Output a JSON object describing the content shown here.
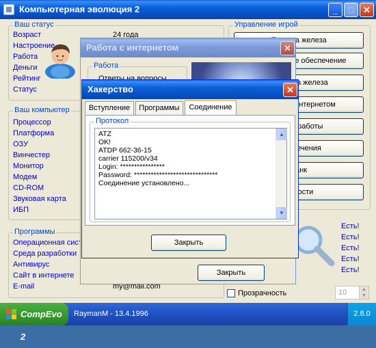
{
  "main_window": {
    "title": "Компьютерная эволюция 2",
    "status": {
      "title": "Ваш статус",
      "rows": [
        {
          "label": "Возраст",
          "value": "24 года"
        },
        {
          "label": "Настроение",
          "value": ""
        },
        {
          "label": "Работа",
          "value": ""
        },
        {
          "label": "Деньги",
          "value": ""
        },
        {
          "label": "Рейтинг",
          "value": ""
        },
        {
          "label": "Статус",
          "value": ""
        }
      ]
    },
    "computer": {
      "title": "Ваш компьютер",
      "items": [
        "Процессор",
        "Платформа",
        "ОЗУ",
        "Винчестер",
        "Монитор",
        "Модем",
        "CD-ROM",
        "Звуковая карта",
        "ИБП"
      ]
    },
    "programs": {
      "title": "Программы",
      "items": [
        "Операционная сист",
        "Среда разработки",
        "Антивирус",
        "Сайт в интернете",
        "E-mail"
      ],
      "email_value": "my@mail.com"
    },
    "control": {
      "title": "Управление игрой",
      "buttons": [
        "Покупка железа",
        "Программное обеспечение",
        "Продажа железа",
        "Работа с интернетом",
        "Поиск работы",
        "Развлечения",
        "Банк",
        "Новости"
      ]
    },
    "has_list": [
      "Есть!",
      "Есть!",
      "Есть!",
      "Есть!",
      "Есть!"
    ],
    "transparency_label": "Прозрачность",
    "transparency_value": "10"
  },
  "internet_window": {
    "title": "Работа с интернетом",
    "group_title": "Работа",
    "group_line": "Ответы на вопросы",
    "close_label": "Закрыть"
  },
  "hacking_window": {
    "title": "Хакерство",
    "tabs": [
      "Вступление",
      "Программы",
      "Соединение"
    ],
    "active_tab": "Соединение",
    "protocol_title": "Протокол",
    "protocol_lines": [
      "ATZ",
      "OK!",
      "ATDP 662-36-15",
      "carrier 115200/v34",
      "Login: ****************",
      "Password: ******************************",
      "Соединение установлено..."
    ],
    "close_label": "Закрыть"
  },
  "taskbar": {
    "start_label": "CompEvo 2",
    "task_label": "RaymanM - 13.4.1996",
    "version": "2.8.0"
  },
  "colors": {
    "accent": "#0a5fd8",
    "link": "#0000c8",
    "group_title": "#0046d5",
    "close_button": "#c7361b"
  }
}
